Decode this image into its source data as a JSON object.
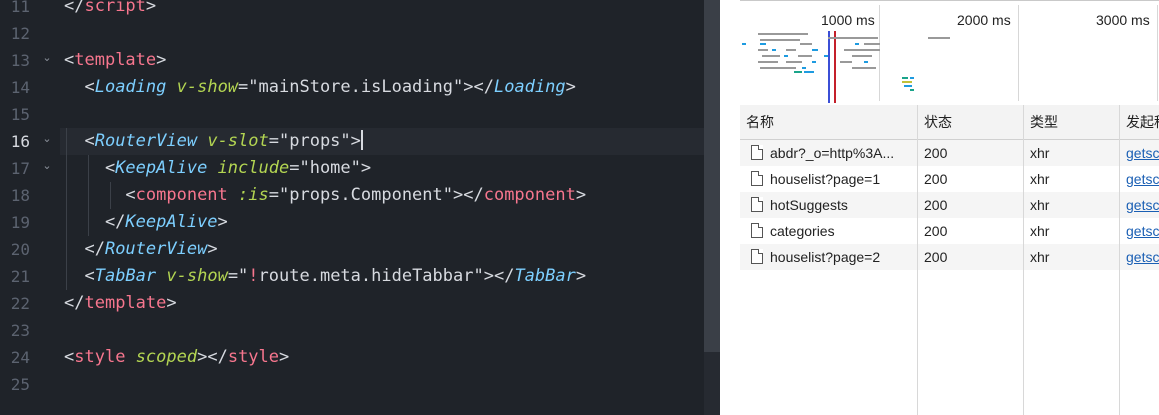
{
  "editor": {
    "lines": [
      {
        "num": "11",
        "tokens": [
          {
            "t": "punc",
            "v": "</"
          },
          {
            "t": "tag",
            "v": "script"
          },
          {
            "t": "punc",
            "v": ">"
          }
        ]
      },
      {
        "num": "12",
        "tokens": []
      },
      {
        "num": "13",
        "fold": "⌄",
        "tokens": [
          {
            "t": "punc",
            "v": "<"
          },
          {
            "t": "tag",
            "v": "template"
          },
          {
            "t": "punc",
            "v": ">"
          }
        ]
      },
      {
        "num": "14",
        "tokens": [
          {
            "t": "punc",
            "v": "  <"
          },
          {
            "t": "comp",
            "v": "Loading"
          },
          {
            "t": "text",
            "v": " "
          },
          {
            "t": "attr",
            "v": "v-show"
          },
          {
            "t": "punc",
            "v": "=\""
          },
          {
            "t": "text",
            "v": "mainStore.isLoading"
          },
          {
            "t": "punc",
            "v": "\"></"
          },
          {
            "t": "comp",
            "v": "Loading"
          },
          {
            "t": "punc",
            "v": ">"
          }
        ]
      },
      {
        "num": "15",
        "tokens": []
      },
      {
        "num": "16",
        "fold": "⌄",
        "active": true,
        "tokens": [
          {
            "t": "punc",
            "v": "  <"
          },
          {
            "t": "comp",
            "v": "RouterView"
          },
          {
            "t": "text",
            "v": " "
          },
          {
            "t": "attr",
            "v": "v-slot"
          },
          {
            "t": "punc",
            "v": "=\""
          },
          {
            "t": "text",
            "v": "props"
          },
          {
            "t": "punc",
            "v": "\">"
          }
        ]
      },
      {
        "num": "17",
        "fold": "⌄",
        "tokens": [
          {
            "t": "punc",
            "v": "    <"
          },
          {
            "t": "comp",
            "v": "KeepAlive"
          },
          {
            "t": "text",
            "v": " "
          },
          {
            "t": "attr",
            "v": "include"
          },
          {
            "t": "punc",
            "v": "=\""
          },
          {
            "t": "text",
            "v": "home"
          },
          {
            "t": "punc",
            "v": "\">"
          }
        ]
      },
      {
        "num": "18",
        "tokens": [
          {
            "t": "punc",
            "v": "      <"
          },
          {
            "t": "tag",
            "v": "component"
          },
          {
            "t": "text",
            "v": " "
          },
          {
            "t": "attr",
            "v": ":is"
          },
          {
            "t": "punc",
            "v": "=\""
          },
          {
            "t": "text",
            "v": "props.Component"
          },
          {
            "t": "punc",
            "v": "\"></"
          },
          {
            "t": "tag",
            "v": "component"
          },
          {
            "t": "punc",
            "v": ">"
          }
        ]
      },
      {
        "num": "19",
        "tokens": [
          {
            "t": "punc",
            "v": "    </"
          },
          {
            "t": "comp",
            "v": "KeepAlive"
          },
          {
            "t": "punc",
            "v": ">"
          }
        ]
      },
      {
        "num": "20",
        "tokens": [
          {
            "t": "punc",
            "v": "  </"
          },
          {
            "t": "comp",
            "v": "RouterView"
          },
          {
            "t": "punc",
            "v": ">"
          }
        ]
      },
      {
        "num": "21",
        "tokens": [
          {
            "t": "punc",
            "v": "  <"
          },
          {
            "t": "comp",
            "v": "TabBar"
          },
          {
            "t": "text",
            "v": " "
          },
          {
            "t": "attr",
            "v": "v-show"
          },
          {
            "t": "punc",
            "v": "=\""
          },
          {
            "t": "bang",
            "v": "!"
          },
          {
            "t": "text",
            "v": "route.meta.hideTabbar"
          },
          {
            "t": "punc",
            "v": "\"></"
          },
          {
            "t": "comp",
            "v": "TabBar"
          },
          {
            "t": "punc",
            "v": ">"
          }
        ]
      },
      {
        "num": "22",
        "tokens": [
          {
            "t": "punc",
            "v": "</"
          },
          {
            "t": "tag",
            "v": "template"
          },
          {
            "t": "punc",
            "v": ">"
          }
        ]
      },
      {
        "num": "23",
        "tokens": []
      },
      {
        "num": "24",
        "tokens": [
          {
            "t": "punc",
            "v": "<"
          },
          {
            "t": "tag",
            "v": "style"
          },
          {
            "t": "text",
            "v": " "
          },
          {
            "t": "attr",
            "v": "scoped"
          },
          {
            "t": "punc",
            "v": "></"
          },
          {
            "t": "tag",
            "v": "style"
          },
          {
            "t": "punc",
            "v": ">"
          }
        ]
      },
      {
        "num": "25",
        "tokens": []
      }
    ]
  },
  "devtools": {
    "timeline": {
      "labels": [
        "1000 ms",
        "2000 ms",
        "3000 ms"
      ],
      "marker_colors": [
        "#3b4fd6",
        "#c4202a"
      ]
    },
    "network": {
      "headers": {
        "name": "名称",
        "status": "状态",
        "type": "类型",
        "initiator": "发起程序"
      },
      "rows": [
        {
          "name": "abdr?_o=http%3A...",
          "status": "200",
          "type": "xhr",
          "initiator": "getsc"
        },
        {
          "name": "houselist?page=1",
          "status": "200",
          "type": "xhr",
          "initiator": "getsc"
        },
        {
          "name": "hotSuggests",
          "status": "200",
          "type": "xhr",
          "initiator": "getsc"
        },
        {
          "name": "categories",
          "status": "200",
          "type": "xhr",
          "initiator": "getsc"
        },
        {
          "name": "houselist?page=2",
          "status": "200",
          "type": "xhr",
          "initiator": "getsc"
        }
      ]
    }
  }
}
